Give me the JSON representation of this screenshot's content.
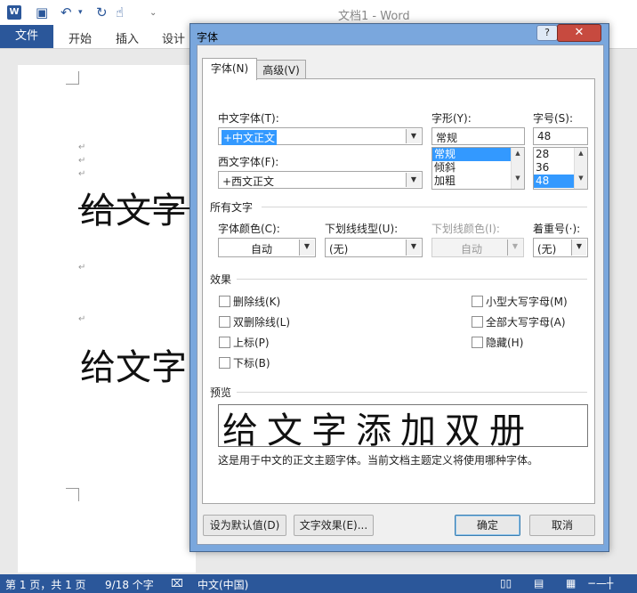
{
  "word": {
    "app_icon": "W",
    "window_title": "文档1 - Word",
    "ribbon_tabs": [
      "文件",
      "开始",
      "插入",
      "设计"
    ],
    "para_mark": "↵",
    "doc_text_1": "给文字",
    "doc_text_2": "给文字",
    "status": {
      "page": "第 1 页，共 1 页",
      "words": "9/18 个字",
      "language": "中文(中国)"
    }
  },
  "dialog": {
    "title": "字体",
    "help": "?",
    "close": "✕",
    "tabs": [
      "字体(N)",
      "高级(V)"
    ],
    "chinese_font": {
      "label": "中文字体(T):",
      "value": "+中文正文"
    },
    "western_font": {
      "label": "西文字体(F):",
      "value": "+西文正文"
    },
    "style": {
      "label": "字形(Y):",
      "value": "常规",
      "options": [
        "常规",
        "倾斜",
        "加粗"
      ],
      "selected": 0
    },
    "size": {
      "label": "字号(S):",
      "value": "48",
      "options": [
        "28",
        "36",
        "48"
      ],
      "selected": 2
    },
    "all_text": {
      "heading": "所有文字",
      "font_color": {
        "label": "字体颜色(C):",
        "value": "自动"
      },
      "underline_style": {
        "label": "下划线线型(U):",
        "value": "(无)"
      },
      "underline_color": {
        "label": "下划线颜色(I):",
        "value": "自动"
      },
      "emphasis": {
        "label": "着重号(·):",
        "value": "(无)"
      }
    },
    "effects": {
      "heading": "效果",
      "left": [
        "删除线(K)",
        "双删除线(L)",
        "上标(P)",
        "下标(B)"
      ],
      "right": [
        "小型大写字母(M)",
        "全部大写字母(A)",
        "隐藏(H)"
      ]
    },
    "preview": {
      "heading": "预览",
      "sample": "给文字添加双册",
      "note": "这是用于中文的正文主题字体。当前文档主题定义将使用哪种字体。"
    },
    "buttons": {
      "set_default": "设为默认值(D)",
      "text_effects": "文字效果(E)...",
      "ok": "确定",
      "cancel": "取消"
    }
  }
}
